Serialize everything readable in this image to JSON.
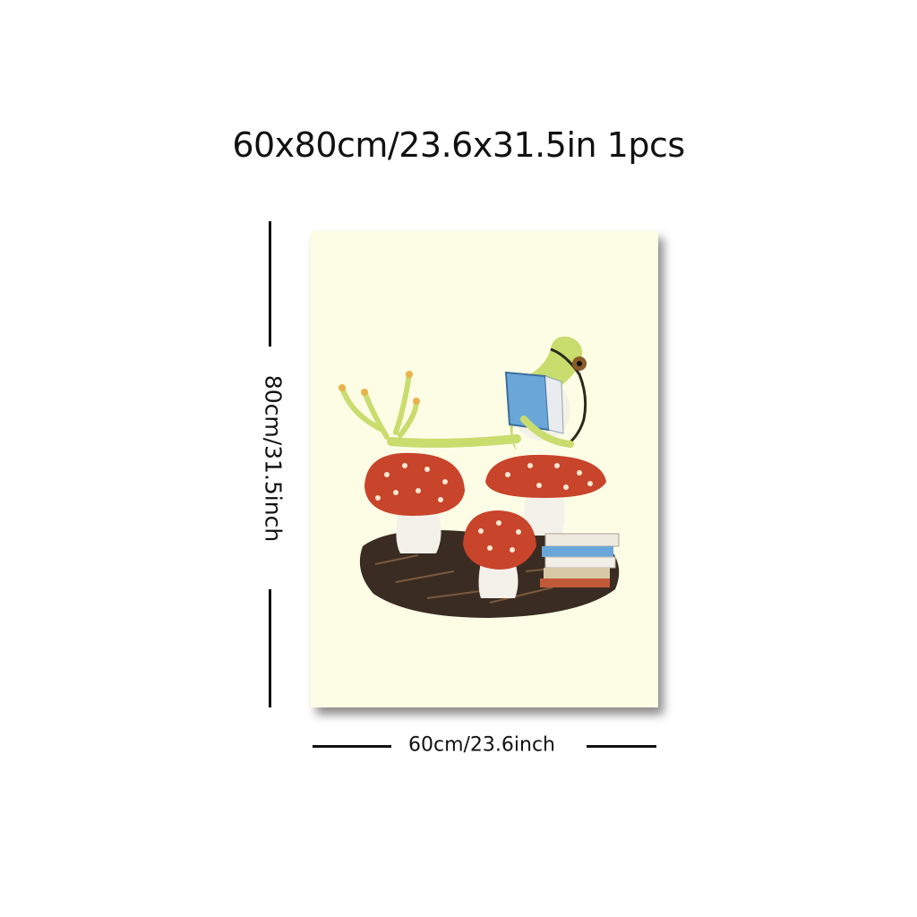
{
  "title": "60x80cm/23.6x31.5in 1pcs",
  "height_label": "80cm/31.5inch",
  "width_label": "60cm/23.6inch",
  "artwork": {
    "subject": "frog-reading-on-mushrooms",
    "colors": {
      "canvas": "#fdfde6",
      "frog": "#c9dc6e",
      "mushroom_cap": "#c8442a",
      "book": "#6aa7d8"
    }
  }
}
